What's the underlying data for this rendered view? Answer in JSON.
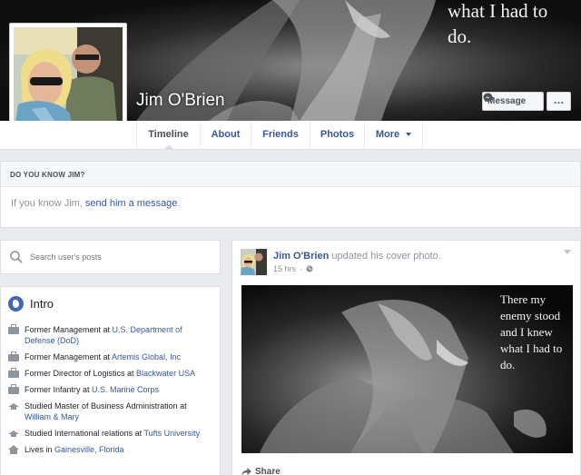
{
  "profile": {
    "name": "Jim O'Brien",
    "cover_quote_lines": [
      "what I had to",
      "do."
    ]
  },
  "actions": {
    "message_label": "Message",
    "more_label": "…"
  },
  "tabs": [
    {
      "label": "Timeline"
    },
    {
      "label": "Friends"
    },
    {
      "label": "About"
    },
    {
      "label": "Photos"
    },
    {
      "label": "More"
    }
  ],
  "know_card": {
    "heading": "DO YOU KNOW JIM?",
    "text_prefix": "If you know Jim, ",
    "link": "send him a message",
    "text_suffix": "."
  },
  "search": {
    "placeholder": "Search user's posts"
  },
  "intro": {
    "title": "Intro",
    "items": [
      {
        "icon": "briefcase-icon",
        "text": "Former Management at ",
        "link": "U.S. Department of Defense (DoD)"
      },
      {
        "icon": "briefcase-icon",
        "text": "Former Management at ",
        "link": "Artemis Global, Inc"
      },
      {
        "icon": "briefcase-icon",
        "text": "Former Director of Logistics at ",
        "link": "Blackwater USA"
      },
      {
        "icon": "briefcase-icon",
        "text": "Former Infantry at ",
        "link": "U.S. Marine Corps"
      },
      {
        "icon": "graduation-cap-icon",
        "text": "Studied Master of Business Administration at ",
        "link": "William & Mary"
      },
      {
        "icon": "graduation-cap-icon",
        "text": "Studied International relations at ",
        "link": "Tufts University"
      },
      {
        "icon": "home-icon",
        "text": "Lives in ",
        "link": "Gainesville, Florida"
      }
    ]
  },
  "post": {
    "author": "Jim O'Brien",
    "action": " updated his cover photo.",
    "time": "15 hrs",
    "privacy_icon": "globe-icon",
    "photo_quote_lines": [
      "There my",
      "enemy stood",
      "and I knew",
      "what I had to",
      "do."
    ],
    "share_label": "Share"
  }
}
